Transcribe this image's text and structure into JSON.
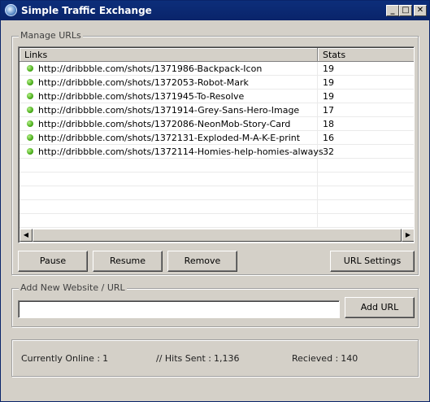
{
  "window": {
    "title": "Simple Traffic Exchange",
    "controls": {
      "minimize": "_",
      "maximize": "□",
      "close": "✕"
    }
  },
  "manage": {
    "group_label": "Manage URLs",
    "columns": [
      "Links",
      "Stats"
    ],
    "rows": [
      {
        "link": "http://dribbble.com/shots/1371986-Backpack-Icon",
        "stats": "19"
      },
      {
        "link": "http://dribbble.com/shots/1372053-Robot-Mark",
        "stats": "19"
      },
      {
        "link": "http://dribbble.com/shots/1371945-To-Resolve",
        "stats": "19"
      },
      {
        "link": "http://dribbble.com/shots/1371914-Grey-Sans-Hero-Image",
        "stats": "17"
      },
      {
        "link": "http://dribbble.com/shots/1372086-NeonMob-Story-Card",
        "stats": "18"
      },
      {
        "link": "http://dribbble.com/shots/1372131-Exploded-M-A-K-E-print",
        "stats": "16"
      },
      {
        "link": "http://dribbble.com/shots/1372114-Homies-help-homies-always",
        "stats": "32"
      }
    ],
    "status_color": "#4caf1c",
    "buttons": {
      "pause": "Pause",
      "resume": "Resume",
      "remove": "Remove",
      "url_settings": "URL Settings"
    }
  },
  "add": {
    "group_label": "Add New Website / URL",
    "input_value": "",
    "button": "Add URL"
  },
  "status": {
    "online_label": "Currently Online :",
    "online_value": "1",
    "hits_label": "//  Hits Sent :",
    "hits_value": "1,136",
    "received_label": "Recieved :",
    "received_value": "140"
  }
}
